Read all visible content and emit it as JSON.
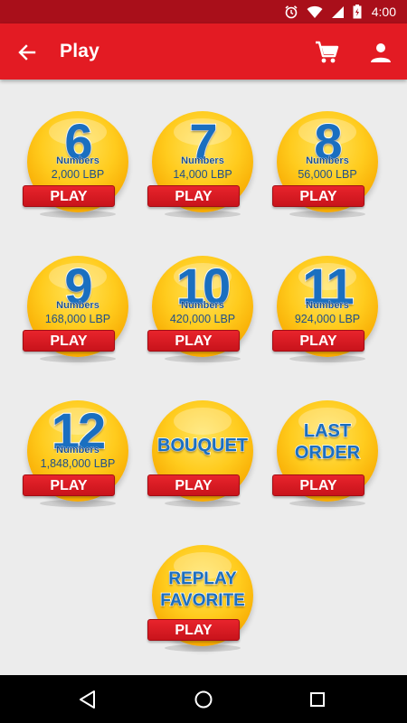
{
  "status_bar": {
    "time": "4:00"
  },
  "app_bar": {
    "title": "Play",
    "back_icon": "arrow-back-icon",
    "cart_icon": "cart-icon",
    "user_icon": "person-icon"
  },
  "colors": {
    "app_bar": "#e31b23",
    "status_bar": "#a90f1a",
    "ball": "#ffc21a",
    "number_text": "#1a6fc0",
    "play_button": "#e31b23",
    "background": "#ececec"
  },
  "cards": [
    {
      "big": "6",
      "label": "Numbers",
      "price": "2,000 LBP",
      "button": "PLAY"
    },
    {
      "big": "7",
      "label": "Numbers",
      "price": "14,000 LBP",
      "button": "PLAY"
    },
    {
      "big": "8",
      "label": "Numbers",
      "price": "56,000 LBP",
      "button": "PLAY"
    },
    {
      "big": "9",
      "label": "Numbers",
      "price": "168,000 LBP",
      "button": "PLAY"
    },
    {
      "big": "10",
      "label": "Numbers",
      "price": "420,000 LBP",
      "button": "PLAY"
    },
    {
      "big": "11",
      "label": "Numbers",
      "price": "924,000 LBP",
      "button": "PLAY"
    },
    {
      "big": "12",
      "label": "Numbers",
      "price": "1,848,000 LBP",
      "button": "PLAY"
    },
    {
      "word": "BOUQUET",
      "button": "PLAY"
    },
    {
      "word1": "LAST",
      "word2": "ORDER",
      "button": "PLAY"
    },
    {
      "word1": "REPLAY",
      "word2": "FAVORITE",
      "button": "PLAY"
    }
  ],
  "nav_bar": {
    "back": "nav-back-icon",
    "home": "nav-home-icon",
    "recents": "nav-recents-icon"
  }
}
